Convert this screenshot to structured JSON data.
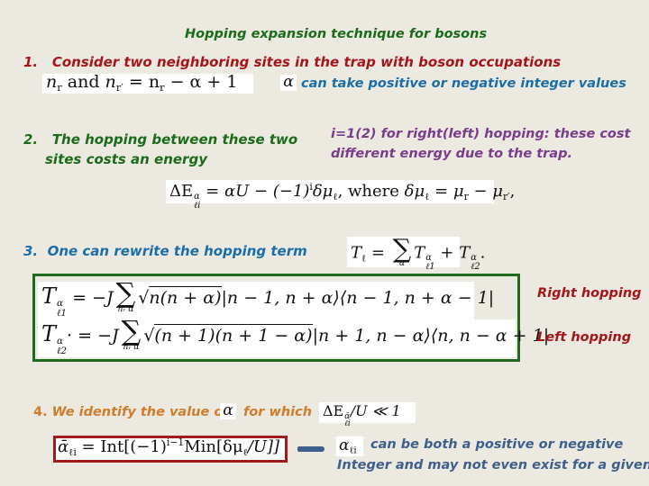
{
  "slide": {
    "title": "Hopping expansion technique for bosons",
    "items": [
      {
        "number": "1.",
        "text": "Consider two neighboring sites in  the trap with boson occupations",
        "math": {
          "n_r": "n",
          "r_sub": "r",
          "and": "and",
          "n_rprime": "n",
          "rprime_sub": "r′",
          "rhs": "= n",
          "rhs_sub": "r",
          "rhs_tail": " − α + 1"
        },
        "alpha_symbol": "α",
        "note": "can take positive or negative integer values"
      },
      {
        "number": "2.",
        "line1": "The hopping between these two",
        "line2": "sites costs an energy",
        "side_note_line1": "i=1(2) for right(left) hopping: these cost",
        "side_note_line2": "different energy due to the trap.",
        "equation": {
          "lhs": "ΔE",
          "lhs_sup": "α",
          "lhs_sub": "ℓi",
          "rhs1": " = αU − (−1)",
          "rhs1_sup": "i",
          "rhs2": "δμ",
          "rhs2_sub": "ℓ",
          "where": ", where ",
          "def": "δμ",
          "def_sub": "ℓ",
          "def_rhs": " = μ",
          "def_rhs_sub": "r",
          "def_minus": " − μ",
          "def_minus_sub": "r′",
          "tail": ","
        }
      },
      {
        "number": "3.",
        "text": "One can rewrite the hopping term",
        "equation": {
          "lhs": "T",
          "lhs_sub": "ℓ",
          "eq": " = ",
          "sum": "∑",
          "sum_under": "α",
          "term1": "T",
          "term1_sup": "α",
          "term1_sub": "ℓ1",
          "plus": " + T",
          "term2_sup": "α",
          "term2_sub": "ℓ2",
          "tail": "."
        },
        "hopping_terms": [
          {
            "lhs": "T",
            "lhs_sup": "α",
            "lhs_sub": "ℓ1",
            "eq": " = −J",
            "sum": "∑",
            "sum_under": "nᵣ α",
            "sqrt": "n",
            "sqrt_body": "(n + α)",
            "ket": "|n − 1, n + α⟩⟨n − 1, n + α − 1|",
            "label": "Right hopping"
          },
          {
            "lhs": "T",
            "lhs_sup": "α",
            "lhs_sub": "ℓ2",
            "lhs_tail": "·",
            "eq": " = −J",
            "sum": "∑",
            "sum_under": "nᵣ α",
            "sqrt_body": "(n + 1)(n + 1 − α)",
            "ket": "|n + 1, n − α⟩⟨n, n − α + 1|",
            "label": "Left hopping"
          }
        ]
      },
      {
        "number": "4.",
        "text_before": "We identify the value of",
        "alpha_symbol": "α",
        "text_after": "for which",
        "condition": {
          "lhs": "ΔE",
          "lhs_sup": "ᾱ",
          "lhs_sub": "ℓi",
          "rhs": "/U  ≪  1"
        },
        "result": {
          "lhs": "ᾱ",
          "lhs_sub": "ℓi",
          "rhs": " =  Int[(−1)",
          "rhs_sup": "i−1",
          "rhs2": "Min[δμ",
          "rhs2_sub": "ℓ",
          "rhs3": "/U]]"
        },
        "conclusion_symbol": "α",
        "conclusion_symbol_sub": "ℓi",
        "conclusion_line1": "can be both a positive or negative",
        "conclusion_line2": "Integer and may not even exist for a given link"
      }
    ]
  },
  "colors": {
    "background": "#ece9e0",
    "title": "#1b6b1b",
    "item1": "#a5161a",
    "item1_note": "#1a6ea8",
    "item2": "#1b6b1b",
    "item2_note": "#7a3d8c",
    "item3": "#1a6ea8",
    "frame_green": "#1e6a1e",
    "hopping_labels": "#a5161a",
    "item4": "#d07c2a",
    "frame_red": "#a01a1a",
    "conclusion": "#3e5f8c"
  }
}
